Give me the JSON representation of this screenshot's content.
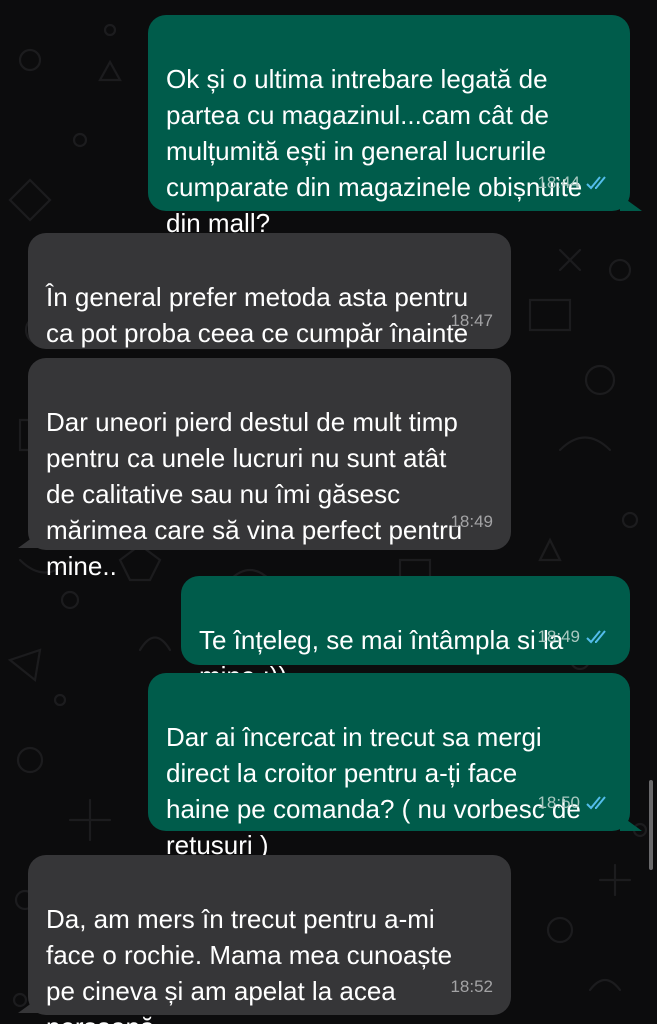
{
  "colors": {
    "background": "#0c0c0d",
    "outgoing_bubble": "#005c4b",
    "incoming_bubble": "#363638",
    "read_ticks": "#53bdeb"
  },
  "messages": [
    {
      "direction": "outgoing",
      "text": "Ok și o ultima intrebare legată de\npartea cu magazinul...cam cât de\nmulțumită ești in general lucrurile\ncumparate din magazinele obișnuite\ndin mall?",
      "time": "18:44",
      "status": "read-ticks-icon"
    },
    {
      "direction": "incoming",
      "text": "În general prefer metoda asta pentru\nca pot proba ceea ce cumpăr înainte",
      "time": "18:47"
    },
    {
      "direction": "incoming",
      "text": "Dar uneori pierd destul de mult timp\npentru ca unele lucruri nu sunt atât\nde calitative sau nu îmi găsesc\nmărimea care să vina perfect pentru\nmine..",
      "time": "18:49"
    },
    {
      "direction": "outgoing",
      "text": "Te înțeleg, se mai întâmpla si la\nmine :))",
      "time": "18:49",
      "status": "read-ticks-icon"
    },
    {
      "direction": "outgoing",
      "text": "Dar ai încercat in trecut sa mergi\ndirect la croitor pentru a-ți face\nhaine pe comanda? ( nu vorbesc de\nretusuri )",
      "time": "18:50",
      "status": "read-ticks-icon"
    },
    {
      "direction": "incoming",
      "text": "Da, am mers în trecut pentru a-mi\nface o rochie. Mama mea cunoaște\npe cineva și am apelat la acea\npersoană.",
      "time": "18:52"
    }
  ]
}
